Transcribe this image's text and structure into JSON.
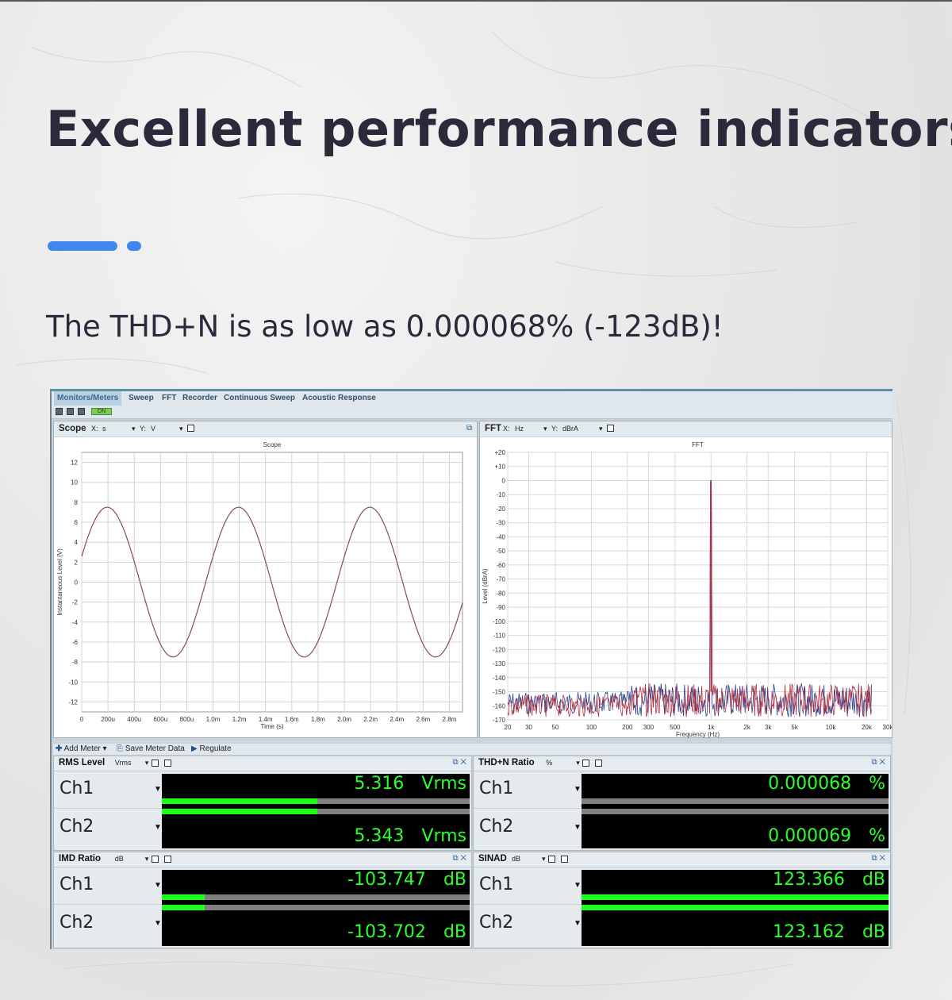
{
  "headline": "Excellent performance indicators",
  "subheadline": "The THD+N is as low as 0.000068% (-123dB)!",
  "accent_color": "#3f86ef",
  "app": {
    "menu": [
      "Monitors/Meters",
      "Sweep",
      "FFT",
      "Recorder",
      "Continuous Sweep",
      "Acoustic Response"
    ],
    "active_menu": "Monitors/Meters",
    "toolbar_on_label": "ON",
    "scope": {
      "panel_title": "Scope",
      "x_label": "X:",
      "x_unit": "s",
      "y_label": "Y:",
      "y_unit": "V",
      "trace_color": "#8a4a5a"
    },
    "fft": {
      "panel_title": "FFT",
      "x_label": "X:",
      "x_unit": "Hz",
      "y_label": "Y:",
      "y_unit": "dBrA"
    },
    "meter_toolbar": {
      "add_meter": "Add Meter",
      "save_meter_data": "Save Meter Data",
      "regulate": "Regulate"
    },
    "meters": [
      {
        "title": "RMS Level",
        "unit_select": "Vrms",
        "channels": [
          {
            "name": "Ch1",
            "value": "5.316",
            "unit": "Vrms",
            "level": 0.505
          },
          {
            "name": "Ch2",
            "value": "5.343",
            "unit": "Vrms",
            "level": 0.505
          }
        ]
      },
      {
        "title": "THD+N Ratio",
        "unit_select": "%",
        "channels": [
          {
            "name": "Ch1",
            "value": "0.000068",
            "unit": "%",
            "level": 0.0
          },
          {
            "name": "Ch2",
            "value": "0.000069",
            "unit": "%",
            "level": 0.0
          }
        ]
      },
      {
        "title": "IMD Ratio",
        "unit_select": "dB",
        "channels": [
          {
            "name": "Ch1",
            "value": "-103.747",
            "unit": "dB",
            "level": 0.14
          },
          {
            "name": "Ch2",
            "value": "-103.702",
            "unit": "dB",
            "level": 0.14
          }
        ]
      },
      {
        "title": "SINAD",
        "unit_select": "dB",
        "channels": [
          {
            "name": "Ch1",
            "value": "123.366",
            "unit": "dB",
            "level": 1.0
          },
          {
            "name": "Ch2",
            "value": "123.162",
            "unit": "dB",
            "level": 1.0
          }
        ]
      }
    ]
  },
  "chart_data": [
    {
      "type": "line",
      "title": "Scope",
      "xlabel": "Time (s)",
      "ylabel": "Instantaneous Level (V)",
      "xlim": [
        0,
        0.0029
      ],
      "ylim": [
        -13,
        13
      ],
      "x_ticks": [
        "0",
        "200u",
        "400u",
        "600u",
        "800u",
        "1.0m",
        "1.2m",
        "1.4m",
        "1.6m",
        "1.8m",
        "2.0m",
        "2.2m",
        "2.4m",
        "2.6m",
        "2.8m"
      ],
      "y_ticks": [
        "12",
        "10",
        "8",
        "6",
        "4",
        "2",
        "0",
        "-2",
        "-4",
        "-6",
        "-8",
        "-10",
        "-12"
      ],
      "series": [
        {
          "amplitude": 7.5,
          "frequency_hz": 1000,
          "phase_offset_s": 0.0,
          "x_start": 0.0,
          "x_end": 0.0029
        }
      ],
      "grid": true
    },
    {
      "type": "line",
      "title": "FFT",
      "xlabel": "Frequency (Hz)",
      "ylabel": "Level (dBrA)",
      "x_scale": "log",
      "xlim": [
        20,
        30000
      ],
      "ylim": [
        -170,
        20
      ],
      "x_ticks": [
        "20",
        "30",
        "50",
        "100",
        "200",
        "300",
        "500",
        "1k",
        "2k",
        "3k",
        "5k",
        "10k",
        "20k",
        "30k"
      ],
      "y_ticks": [
        "+20",
        "+10",
        "0",
        "-10",
        "-20",
        "-30",
        "-40",
        "-50",
        "-60",
        "-70",
        "-80",
        "-90",
        "-100",
        "-110",
        "-120",
        "-130",
        "-140",
        "-150",
        "-160",
        "-170"
      ],
      "fundamental": {
        "frequency_hz": 1000,
        "level_dbra": 0
      },
      "noise_floor_dbra": [
        -168,
        -150
      ],
      "series": [
        {
          "color": "#2a3f8c"
        },
        {
          "color": "#b23040"
        }
      ],
      "grid": true
    }
  ]
}
